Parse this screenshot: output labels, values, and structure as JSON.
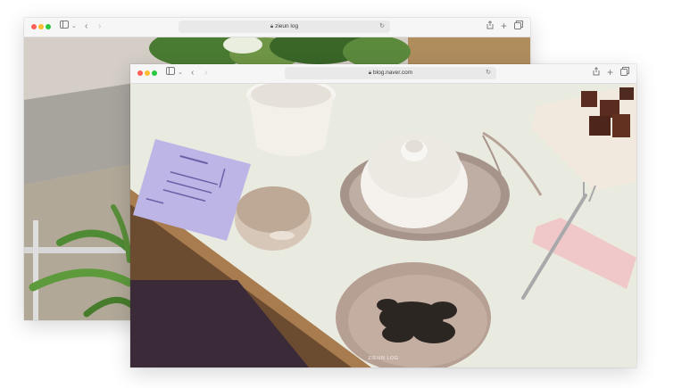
{
  "windows": [
    {
      "id": "back",
      "url": "zieun log",
      "photo_subject": "plants"
    },
    {
      "id": "front",
      "url": "blog.naver.com",
      "photo_subject": "tea set on table",
      "watermark": "ZIEUN LOG"
    }
  ],
  "icons": {
    "lock": "lock-icon",
    "reload": "reload-icon",
    "sidebar": "sidebar-icon",
    "chevron": "chevron-down-icon",
    "back": "back-arrow-icon",
    "forward": "forward-arrow-icon",
    "share": "share-icon",
    "new_tab": "plus-icon",
    "tabs": "tab-overview-icon"
  },
  "colors": {
    "red": "#ff5f57",
    "yellow": "#febc2e",
    "green": "#28c840",
    "toolbar": "#f6f6f6",
    "url_bar": "#e9e9e9"
  }
}
